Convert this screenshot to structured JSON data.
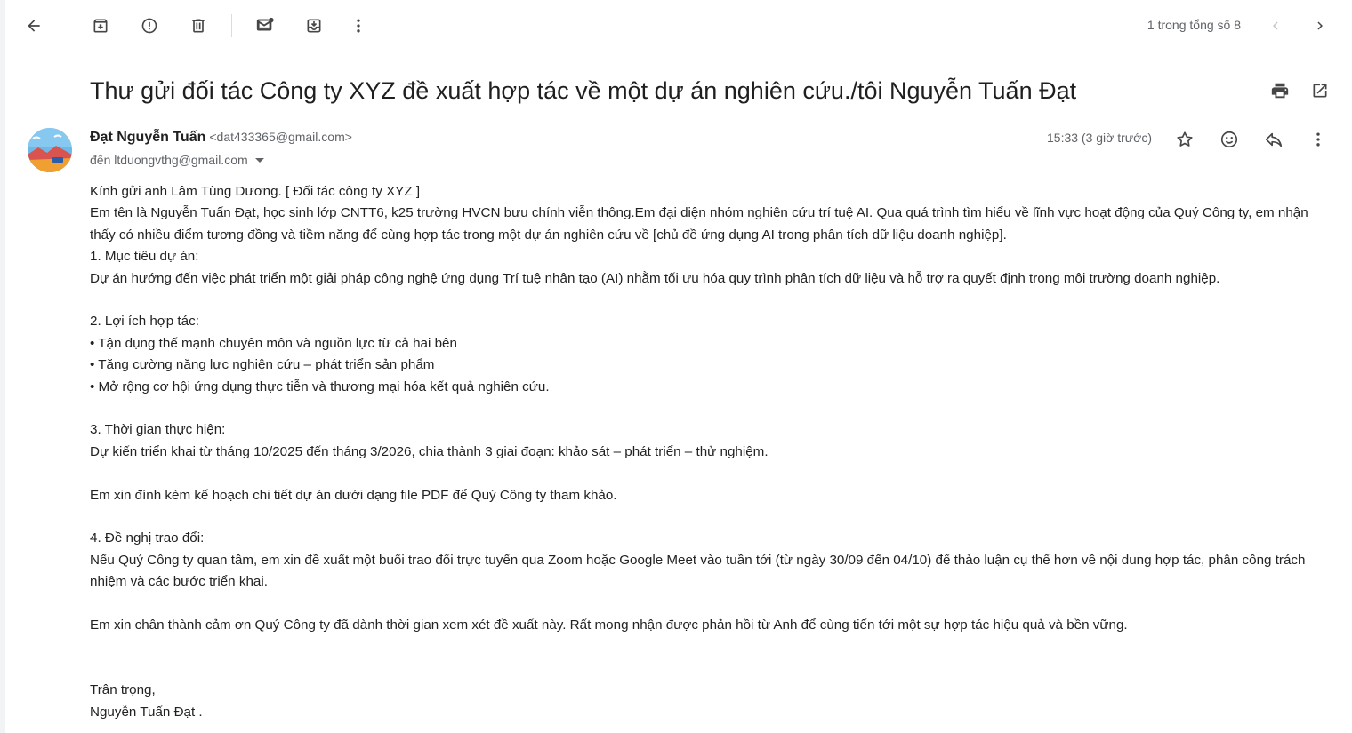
{
  "toolbar": {
    "icons": [
      "back-arrow-icon",
      "archive-icon",
      "report-spam-icon",
      "delete-icon",
      "mark-unread-icon",
      "move-to-icon",
      "more-vert-icon"
    ],
    "pager_text": "1 trong tổng số 8"
  },
  "email": {
    "subject": "Thư gửi đối tác Công ty XYZ đề xuất hợp tác về một dự án nghiên cứu./tôi Nguyễn Tuấn Đạt",
    "sender_name": "Đạt Nguyễn Tuấn",
    "sender_email": "<dat433365@gmail.com>",
    "recipient": "đến ltduongvthg@gmail.com",
    "time": "15:33 (3 giờ trước)",
    "body_lines": [
      "Kính gửi anh Lâm Tùng Dương. [ Đối tác công ty XYZ ]",
      " Em tên là Nguyễn Tuấn Đạt, học sinh lớp CNTT6, k25 trường HVCN bưu chính viễn thông.Em đại diện nhóm nghiên cứu trí tuệ AI. Qua quá trình tìm hiểu về lĩnh vực hoạt động của Quý Công ty, em nhận thấy có nhiều điểm tương đồng và tiềm năng để cùng hợp tác trong một dự án nghiên cứu về [chủ đề ứng dụng AI trong phân tích dữ liệu doanh nghiệp].",
      "1. Mục tiêu dự án:",
      "Dự án hướng đến việc phát triển một giải pháp công nghệ ứng dụng Trí tuệ nhân tạo (AI) nhằm tối ưu hóa quy trình phân tích dữ liệu và hỗ trợ ra quyết định trong môi trường doanh nghiệp.",
      "",
      "2. Lợi ích hợp tác:",
      "• Tận dụng thế mạnh chuyên môn và nguồn lực từ cả hai bên",
      "• Tăng cường năng lực nghiên cứu – phát triển sản phẩm",
      "• Mở rộng cơ hội ứng dụng thực tiễn và thương mại hóa kết quả nghiên cứu.",
      "",
      "3. Thời gian thực hiện:",
      "Dự kiến triển khai từ tháng 10/2025 đến tháng 3/2026, chia thành 3 giai đoạn: khảo sát – phát triển – thử nghiệm.",
      "",
      "Em xin đính kèm kế hoạch chi tiết dự án dưới dạng file PDF để Quý Công ty tham khảo.",
      "",
      "4. Đề nghị trao đổi:",
      "Nếu Quý Công ty quan tâm, em xin đề xuất một buổi trao đổi trực tuyến qua Zoom hoặc Google Meet vào tuần tới (từ ngày 30/09 đến 04/10) để thảo luận cụ thể hơn về nội dung hợp tác, phân công trách nhiệm và các bước triển khai.",
      "",
      "Em xin chân thành cảm ơn Quý Công ty đã dành thời gian xem xét đề xuất này. Rất mong nhận được phản hồi từ Anh để cùng tiến tới một sự hợp tác hiệu quả và bền vững.",
      "",
      "",
      "Trân trọng,",
      "Nguyễn Tuấn Đạt ."
    ]
  },
  "colors": {
    "icon": "#444746",
    "muted": "#5f6368",
    "text": "#1f1f1f"
  }
}
